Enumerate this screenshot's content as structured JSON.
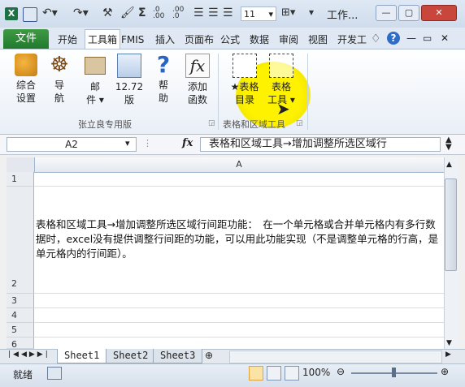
{
  "window": {
    "title": "工作...",
    "font_size": "11",
    "minimize": "—",
    "restore": "▢",
    "close": "✕"
  },
  "qat": {
    "bold_label": "Σ",
    "decimal_up": ".0 .00",
    "decimal_down": ".00 .0"
  },
  "tabs": [
    "文件",
    "开始",
    "工具箱",
    "FMIS",
    "插入",
    "页面布",
    "公式",
    "数据",
    "审阅",
    "视图",
    "开发工"
  ],
  "ribbon": {
    "group1": {
      "label": "张立良专用版",
      "buttons": [
        {
          "line1": "综合",
          "line2": "设置"
        },
        {
          "line1": "导",
          "line2": "航"
        },
        {
          "line1": "邮",
          "line2": "件 ▾"
        },
        {
          "line1": "12.72",
          "line2": "版"
        },
        {
          "line1": "帮",
          "line2": "助"
        },
        {
          "line1": "添加",
          "line2": "函数"
        }
      ]
    },
    "group2": {
      "label": "表格和区域工具",
      "buttons": [
        {
          "line1": "★表格",
          "line2": "目录"
        },
        {
          "line1": "表格",
          "line2": "工具 ▾"
        }
      ]
    }
  },
  "formula_bar": {
    "name_box": "A2",
    "fx": "fx",
    "formula": "表格和区域工具→增加调整所选区域行"
  },
  "grid": {
    "column_a": "A",
    "rows": [
      "1",
      "2",
      "3",
      "4",
      "5",
      "6"
    ],
    "cell_text": "表格和区域工具→增加调整所选区域行间距功能：　在一个单元格或合并单元格内有多行数据时，excel没有提供调整行间距的功能，可以用此功能实现（不是调整单元格的行高，是单元格内的行间距）。"
  },
  "sheets": [
    "Sheet1",
    "Sheet2",
    "Sheet3"
  ],
  "status": {
    "ready": "就绪",
    "zoom": "100%"
  },
  "colors": {
    "file_tab": "#217a2d",
    "highlight": "#fff200"
  }
}
